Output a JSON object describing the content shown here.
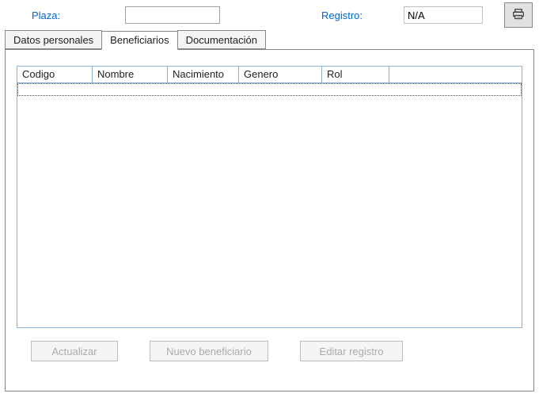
{
  "header": {
    "plaza_label": "Plaza:",
    "plaza_value": "",
    "registro_label": "Registro:",
    "registro_value": "N/A"
  },
  "tabs": {
    "personal": "Datos personales",
    "beneficiarios": "Beneficiarios",
    "documentacion": "Documentación",
    "active": "beneficiarios"
  },
  "grid": {
    "headers": {
      "codigo": "Codigo",
      "nombre": "Nombre",
      "nacimiento": "Nacimiento",
      "genero": "Genero",
      "rol": "Rol"
    },
    "rows": []
  },
  "buttons": {
    "actualizar": "Actualizar",
    "nuevo": "Nuevo beneficiario",
    "editar": "Editar registro"
  },
  "icons": {
    "print": "print-icon"
  }
}
